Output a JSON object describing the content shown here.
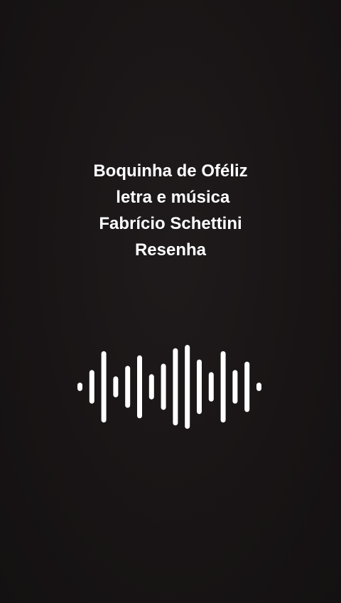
{
  "caption": {
    "lines": [
      "Boquinha de Oféliz",
      " letra e música",
      "Fabrício Schettini",
      "Resenha"
    ]
  },
  "waveform": {
    "icon": "audio-waveform-icon",
    "color": "#ffffff",
    "levels": [
      0.1,
      0.4,
      0.85,
      0.25,
      0.5,
      0.75,
      0.3,
      0.55,
      0.92,
      1.0,
      0.65,
      0.35,
      0.85,
      0.4,
      0.6,
      0.1
    ]
  }
}
